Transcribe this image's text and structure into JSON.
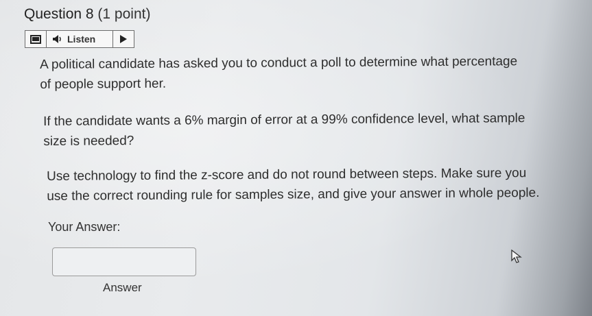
{
  "question": {
    "label": "Question 8",
    "points": "(1 point)"
  },
  "toolbar": {
    "menu_icon": "menu-icon",
    "speaker_icon": "speaker-icon",
    "listen_label": "Listen",
    "play_icon": "play-icon"
  },
  "body": {
    "paragraph1": {
      "line1": "A political candidate has asked you to conduct a poll to determine what percentage",
      "line2": "of people support her."
    },
    "paragraph2": {
      "line1": "If the candidate wants a 6% margin of error at a 99% confidence level, what sample",
      "line2": "size is needed?"
    },
    "paragraph3": {
      "line1": "Use technology to find the z-score and do not round between steps. Make sure you",
      "line2": "use the correct rounding rule for samples size, and give your answer in whole people."
    }
  },
  "answer": {
    "prompt": "Your Answer:",
    "value": "",
    "caption": "Answer"
  },
  "colors": {
    "text": "#2d2d2d",
    "border": "#6c6c6c",
    "input_border": "#9a9a9a"
  }
}
